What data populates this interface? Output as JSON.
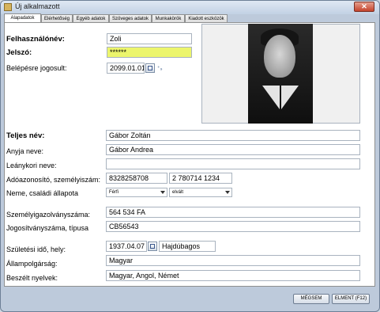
{
  "window": {
    "title": "Új alkalmazott",
    "close_label": "✕"
  },
  "tabs": [
    {
      "label": "Alapadatok"
    },
    {
      "label": "Elérhetőség"
    },
    {
      "label": "Egyéb adatok"
    },
    {
      "label": "Szöveges adatok"
    },
    {
      "label": "Munkakörök"
    },
    {
      "label": "Kiadott eszközök"
    }
  ],
  "form": {
    "username_label": "Felhasználónév:",
    "username_value": "Zoli",
    "password_label": "Jelszó:",
    "password_value": "******",
    "login_label": "Belépésre jogosult:",
    "login_date": "2099.01.01",
    "fullname_label": "Teljes név:",
    "fullname_value": "Gábor Zoltán",
    "mother_label": "Anyja neve:",
    "mother_value": "Gábor Andrea",
    "maiden_label": "Leánykori neve:",
    "maiden_value": "",
    "taxid_label": "Adóazonosító, személyiszám:",
    "taxid_value": "8328258708",
    "personal_no_value": "2 780714 1234",
    "gender_label": "Neme, családi állapota",
    "gender_value": "Férfi",
    "marital_value": "elvált",
    "idcard_label": "Személyigazolványszáma:",
    "idcard_value": "564 534 FA",
    "license_label": "Jogosítványszáma, típusa",
    "license_value": "CB56543",
    "birth_label": "Születési idő, hely:",
    "birth_date": "1937.04.07",
    "birth_place": "Hajdúbagos",
    "citizenship_label": "Állampolgárság:",
    "citizenship_value": "Magyar",
    "languages_label": "Beszélt nyelvek:",
    "languages_value": "Magyar, Angol, Német"
  },
  "buttons": {
    "cancel": "MÉGSEM",
    "save": "ELMENT (F12)"
  },
  "colors": {
    "password_bg": "#ecf56c",
    "window_bg": "#bdcadb"
  }
}
